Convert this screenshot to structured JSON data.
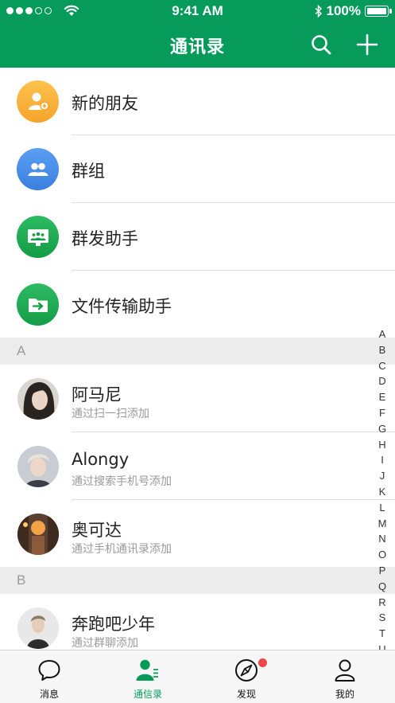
{
  "status_bar": {
    "time": "9:41 AM",
    "battery": "100%"
  },
  "header": {
    "title": "通讯录"
  },
  "function_items": [
    {
      "label": "新的朋友",
      "icon": "add-friend-icon",
      "color": "#f9b43b"
    },
    {
      "label": "群组",
      "icon": "group-icon",
      "color": "#3f87e6"
    },
    {
      "label": "群发助手",
      "icon": "broadcast-icon",
      "color": "#19a852"
    },
    {
      "label": "文件传输助手",
      "icon": "folder-icon",
      "color": "#19a852"
    }
  ],
  "sections": [
    {
      "letter": "A",
      "contacts": [
        {
          "name": "阿马尼",
          "source": "通过扫一扫添加"
        },
        {
          "name": "Alongy",
          "source": "通过搜索手机号添加"
        },
        {
          "name": "奥可达",
          "source": "通过手机通讯录添加"
        }
      ]
    },
    {
      "letter": "B",
      "contacts": [
        {
          "name": "奔跑吧少年",
          "source": "通过群聊添加"
        }
      ]
    }
  ],
  "index_letters": [
    "A",
    "B",
    "C",
    "D",
    "E",
    "F",
    "G",
    "H",
    "I",
    "J",
    "K",
    "L",
    "M",
    "N",
    "O",
    "P",
    "Q",
    "R",
    "S",
    "T",
    "U"
  ],
  "tabs": [
    {
      "label": "消息",
      "icon": "chat-bubble-icon",
      "active": false
    },
    {
      "label": "通信录",
      "icon": "contacts-icon",
      "active": true
    },
    {
      "label": "发现",
      "icon": "compass-icon",
      "active": false,
      "badge": true
    },
    {
      "label": "我的",
      "icon": "profile-icon",
      "active": false
    }
  ],
  "colors": {
    "brand": "#069b5a",
    "badge": "#f04848"
  }
}
